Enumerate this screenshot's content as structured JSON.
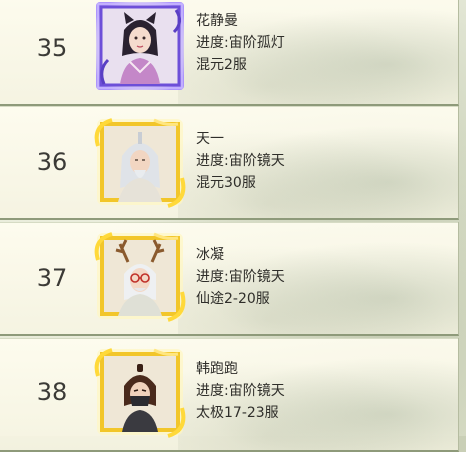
{
  "rankings": [
    {
      "rank": "35",
      "name": "花静曼",
      "progress": "进度:宙阶孤灯",
      "server": "混元2服",
      "frame_style": "purple",
      "avatar": "woman-with-cat-ears-icon"
    },
    {
      "rank": "36",
      "name": "天一",
      "progress": "进度:宙阶镜天",
      "server": "混元30服",
      "frame_style": "gold",
      "avatar": "white-haired-elder-icon"
    },
    {
      "rank": "37",
      "name": "冰凝",
      "progress": "进度:宙阶镜天",
      "server": "仙途2-20服",
      "frame_style": "gold",
      "avatar": "antlered-glasses-character-icon"
    },
    {
      "rank": "38",
      "name": "韩跑跑",
      "progress": "进度:宙阶镜天",
      "server": "太极17-23服",
      "frame_style": "gold",
      "avatar": "masked-swordsman-icon"
    }
  ],
  "colors": {
    "gold_frame": "#f2c62a",
    "purple_frame": "#8b6cf0",
    "row_border": "#8e9a7a"
  }
}
